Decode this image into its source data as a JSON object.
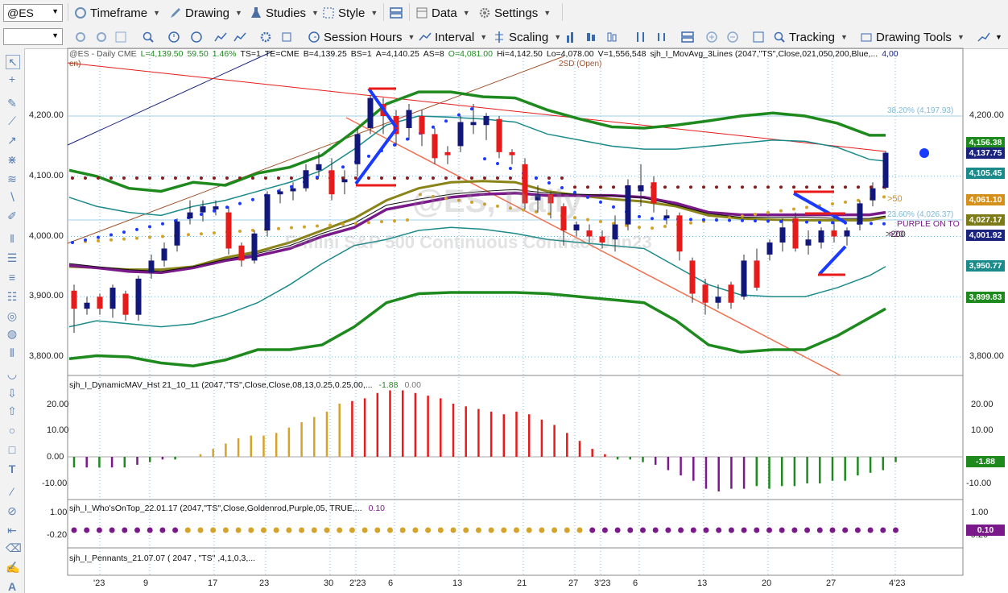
{
  "toolbar": {
    "symbol": "@ES",
    "timeframe": "Timeframe",
    "drawing": "Drawing",
    "studies": "Studies",
    "style": "Style",
    "data": "Data",
    "settings": "Settings",
    "session_hours": "Session Hours",
    "interval": "Interval",
    "scaling": "Scaling",
    "tracking": "Tracking",
    "drawing_tools": "Drawing Tools"
  },
  "header": {
    "symbol_info": "@ES - Daily  CME",
    "last": "L=4,139.50",
    "change": "59.50",
    "change_pct": "1.46%",
    "ts": "TS=1",
    "te": "TE=CME",
    "bid": "B=4,139.25",
    "bs": "BS=1",
    "ask": "A=4,140.25",
    "as": "AS=8",
    "open": "O=4,081.00",
    "high": "Hi=4,142.50",
    "low": "Lo=4,078.00",
    "volume": "V=1,556,548",
    "study": "sjh_I_MovAvg_3Lines (2047,\"TS\",Close,021,050,200,Blue,...",
    "study_value": "4,00",
    "en_fragment": "en)"
  },
  "watermark": {
    "line1": "@ES, Daily",
    "line2": "E-mini S&P 500 Continuous Contract Jun23"
  },
  "annotations": {
    "sd": "2SD (Open)",
    "fib382": "38.20% (4,197.93)",
    "fib236": "23.60% (4,026.37)",
    "gt50": ">50",
    "gt20": ">20",
    "gt200": ">200",
    "purple_on_top": "PURPLE ON TO"
  },
  "price_axis": [
    "4,200.00",
    "4,100.00",
    "4,000.00",
    "3,900.00",
    "3,800.00"
  ],
  "price_tags": [
    {
      "value": "4,156.38",
      "color": "#1e8a1e"
    },
    {
      "value": "4,137.75",
      "color": "#1a237e"
    },
    {
      "value": "4,105.45",
      "color": "#1b8a8a"
    },
    {
      "value": "4,061.10",
      "color": "#d4901a"
    },
    {
      "value": "4,027.17",
      "color": "#7d7a18"
    },
    {
      "value": "4,001.92",
      "color": "#1a237e"
    },
    {
      "value": "3,950.77",
      "color": "#1b8a8a"
    },
    {
      "value": "3,899.83",
      "color": "#1e8a1e"
    }
  ],
  "macd_pane": {
    "label": "sjh_I_DynamicMAV_Hst 21_10_11 (2047,\"TS\",Close,Close,08,13,0.25,0.25,00,...",
    "value1": "-1.88",
    "value2": "0.00",
    "axis": [
      "20.00",
      "10.00",
      "0.00",
      "-10.00"
    ],
    "tag": "-1.88",
    "tag_color": "#1e8a1e"
  },
  "whos_pane": {
    "label": "sjh_I_Who'sOnTop_22.01.17 (2047,\"TS\",Close,Goldenrod,Purple,05, TRUE,...",
    "value": "0.10",
    "axis": [
      "1.00",
      "-0.20"
    ],
    "tag": "0.10",
    "tag_color": "#7a1a8a"
  },
  "pennants_pane": {
    "label": "sjh_I_Pennants_21.07.07 ( 2047 , \"TS\" ,4,1,0,3,..."
  },
  "date_axis": [
    "'23",
    "9",
    "17",
    "23",
    "30",
    "2'23",
    "6",
    "13",
    "21",
    "27",
    "3'23",
    "6",
    "13",
    "20",
    "27",
    "4'23"
  ],
  "colors": {
    "bull": "#12177a",
    "bear": "#e81a1a",
    "outer_band": "#1e8a1e",
    "inner_band": "#1b8a8a",
    "ma_purple": "#7a1a8a",
    "ma_olive": "#8a8418",
    "goldenrod": "#d4a32a"
  }
}
